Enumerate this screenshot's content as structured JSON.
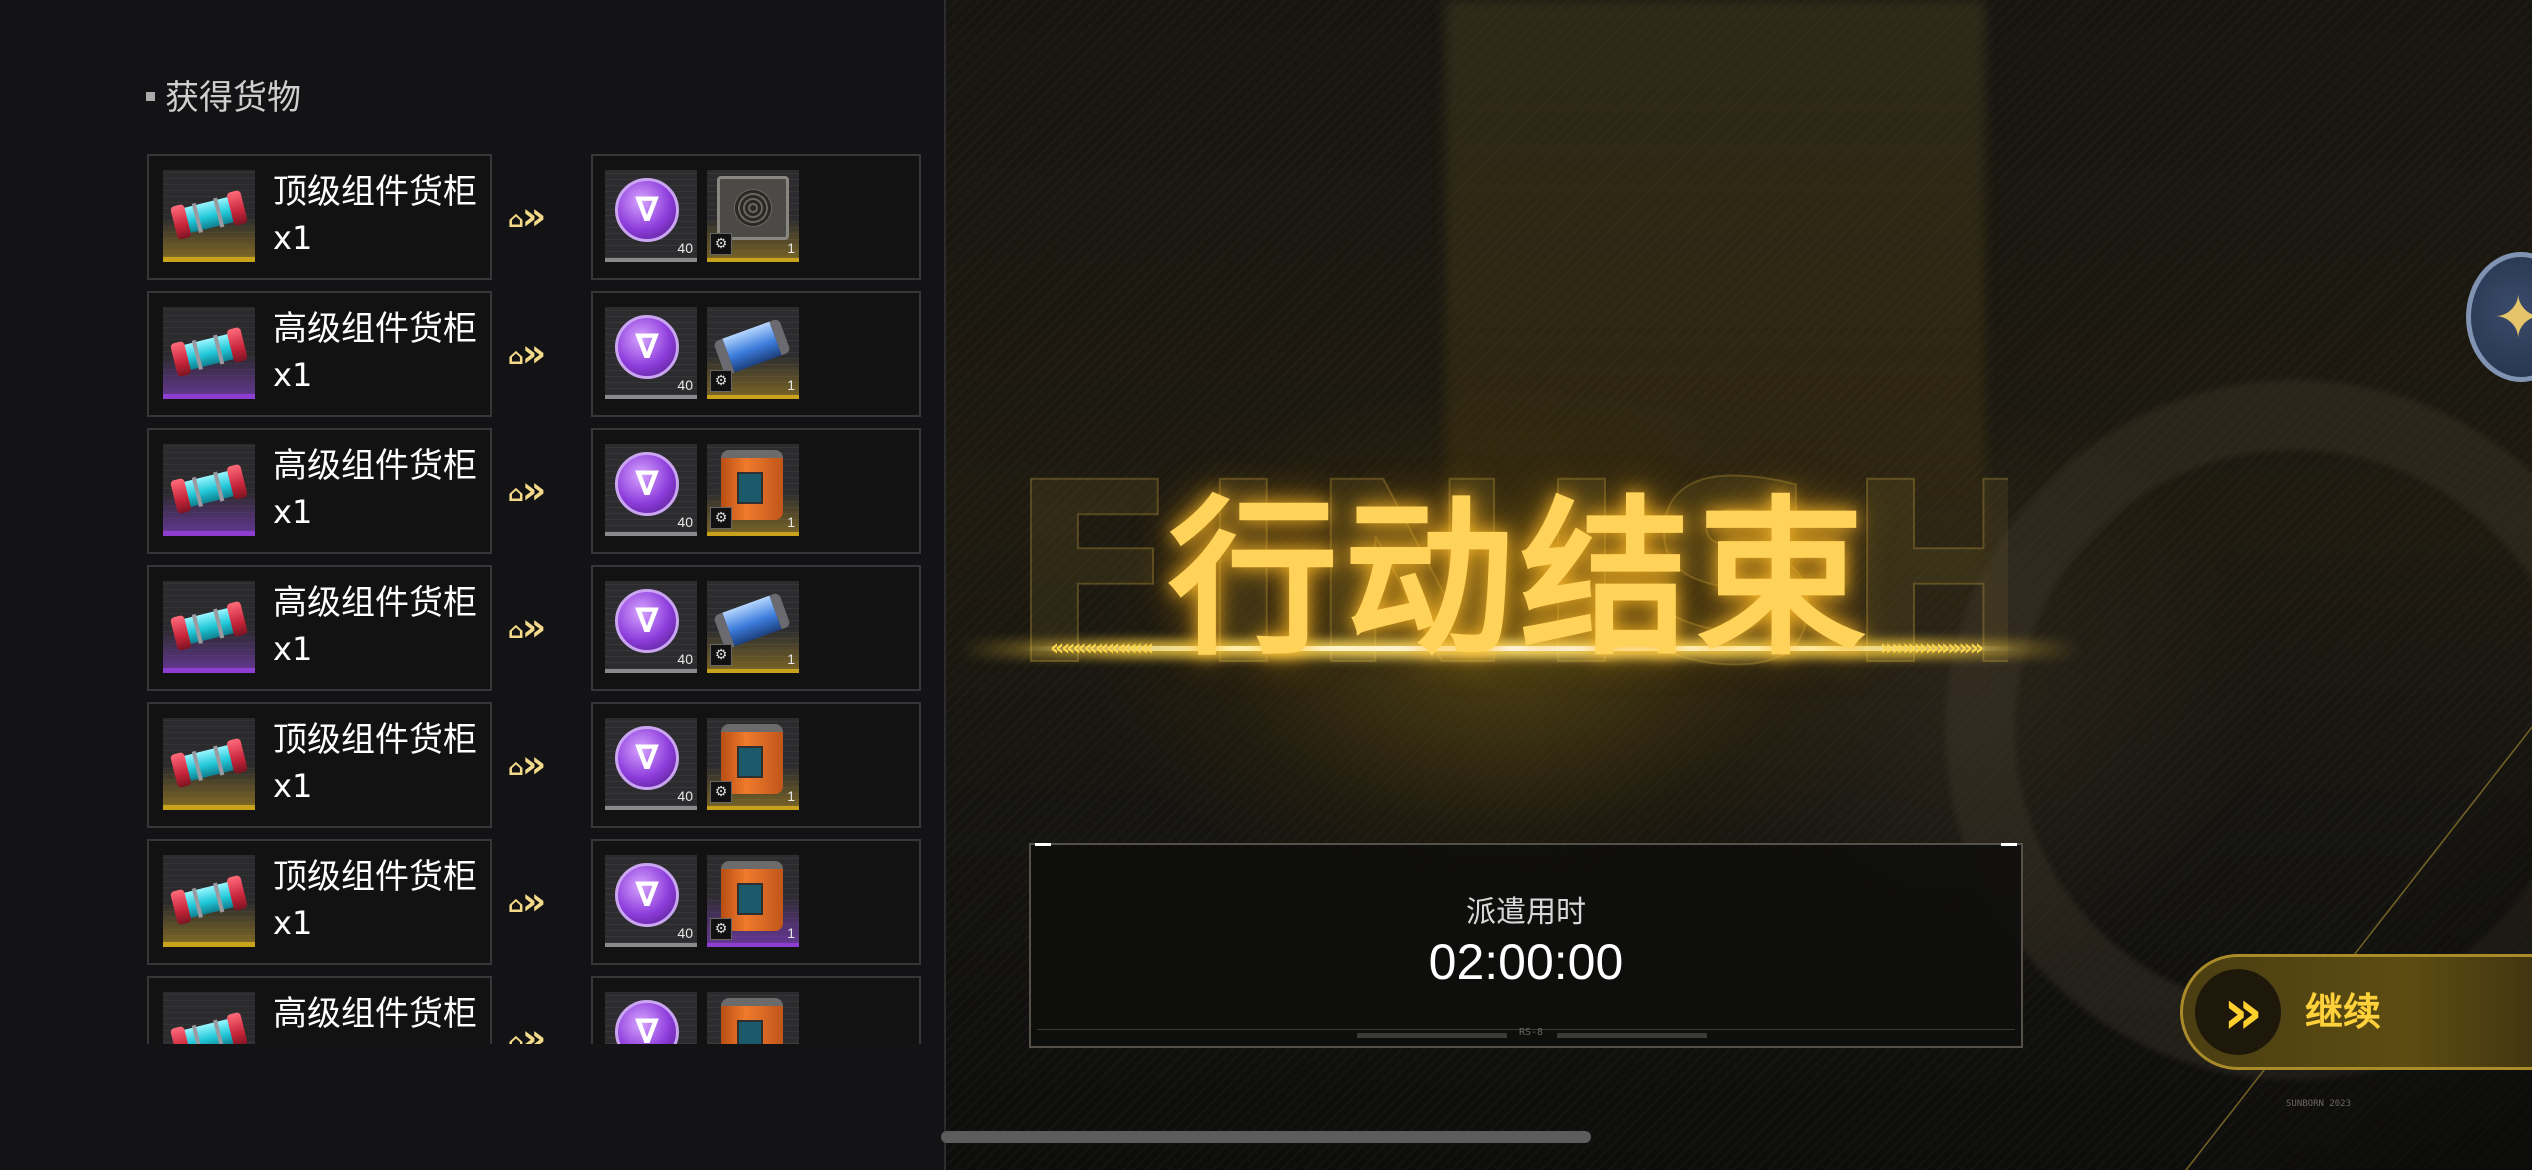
{
  "header": {
    "cargo_title": "获得货物"
  },
  "cargo_rows": [
    {
      "name": "顶级组件货柜",
      "qty": "x1",
      "rarity": "gold",
      "rewards": [
        {
          "icon": "purple-token-icon",
          "count": "40",
          "rarity": "gray"
        },
        {
          "icon": "circuit-device-icon",
          "count": "1",
          "rarity": "gold"
        }
      ]
    },
    {
      "name": "高级组件货柜",
      "qty": "x1",
      "rarity": "purple",
      "rewards": [
        {
          "icon": "purple-token-icon",
          "count": "40",
          "rarity": "gray"
        },
        {
          "icon": "blue-canister-icon",
          "count": "1",
          "rarity": "gold"
        }
      ]
    },
    {
      "name": "高级组件货柜",
      "qty": "x1",
      "rarity": "purple",
      "rewards": [
        {
          "icon": "purple-token-icon",
          "count": "40",
          "rarity": "gray"
        },
        {
          "icon": "orange-tank-icon",
          "count": "1",
          "rarity": "gold"
        }
      ]
    },
    {
      "name": "高级组件货柜",
      "qty": "x1",
      "rarity": "purple",
      "rewards": [
        {
          "icon": "purple-token-icon",
          "count": "40",
          "rarity": "gray"
        },
        {
          "icon": "blue-canister-icon",
          "count": "1",
          "rarity": "gold"
        }
      ]
    },
    {
      "name": "顶级组件货柜",
      "qty": "x1",
      "rarity": "gold",
      "rewards": [
        {
          "icon": "purple-token-icon",
          "count": "40",
          "rarity": "gray"
        },
        {
          "icon": "orange-tank-icon",
          "count": "1",
          "rarity": "gold"
        }
      ]
    },
    {
      "name": "顶级组件货柜",
      "qty": "x1",
      "rarity": "gold",
      "rewards": [
        {
          "icon": "purple-token-icon",
          "count": "40",
          "rarity": "gray"
        },
        {
          "icon": "orange-tank-icon",
          "count": "1",
          "rarity": "purple"
        }
      ]
    },
    {
      "name": "高级组件货柜",
      "qty": "",
      "rarity": "purple",
      "rewards": [
        {
          "icon": "purple-token-icon",
          "count": "",
          "rarity": "gray"
        },
        {
          "icon": "orange-tank-icon",
          "count": "",
          "rarity": "gold"
        }
      ]
    }
  ],
  "result": {
    "background_word": "FINISH",
    "title": "行动结束",
    "time_label": "派遣用时",
    "time_value": "02:00:00",
    "footer_code": "RS-8"
  },
  "actions": {
    "continue_label": "继续"
  },
  "footer": {
    "copyright": "SUNBORN 2023"
  },
  "colors": {
    "accent_gold": "#ffd25a",
    "rarity_gold": "#c9a21c",
    "rarity_purple": "#8d3ed1"
  }
}
